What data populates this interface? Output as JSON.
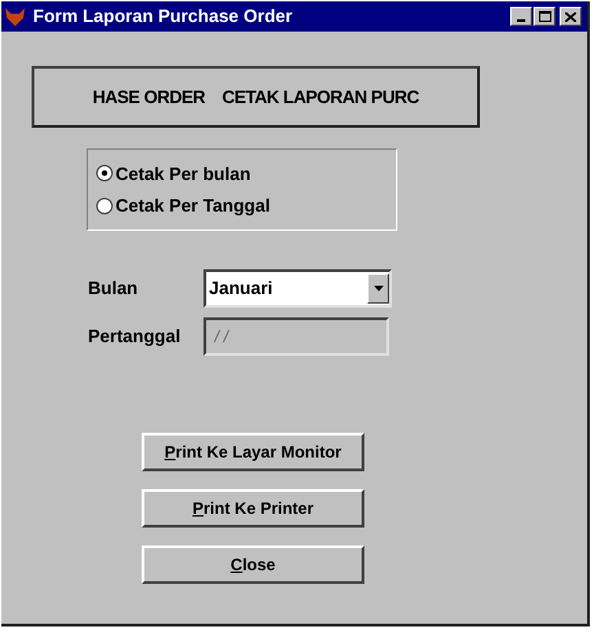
{
  "window": {
    "title": "Form Laporan Purchase Order"
  },
  "banner": {
    "text": "HASE ORDER    CETAK LAPORAN PURC"
  },
  "options": [
    {
      "label": "Cetak Per bulan",
      "selected": true
    },
    {
      "label": "Cetak Per Tanggal",
      "selected": false
    }
  ],
  "bulan": {
    "label": "Bulan",
    "value": "Januari"
  },
  "pertanggal": {
    "label": "Pertanggal",
    "value": "/ /",
    "disabled": true
  },
  "buttons": [
    {
      "mnemonic": "P",
      "rest": "rint Ke Layar Monitor"
    },
    {
      "mnemonic": "P",
      "rest": "rint Ke Printer"
    },
    {
      "mnemonic": "C",
      "rest": "lose"
    }
  ]
}
